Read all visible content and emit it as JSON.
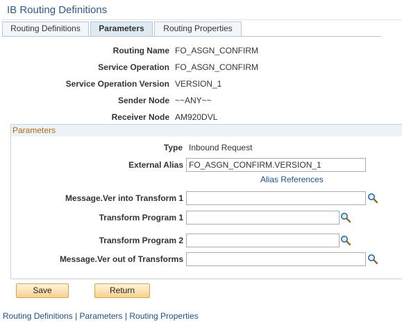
{
  "page": {
    "title": "IB Routing Definitions"
  },
  "tabs": [
    {
      "label": "Routing Definitions",
      "active": false
    },
    {
      "label": "Parameters",
      "active": true
    },
    {
      "label": "Routing Properties",
      "active": false
    }
  ],
  "details": {
    "routing_name_label": "Routing Name",
    "routing_name_value": "FO_ASGN_CONFIRM",
    "service_operation_label": "Service Operation",
    "service_operation_value": "FO_ASGN_CONFIRM",
    "service_operation_version_label": "Service Operation Version",
    "service_operation_version_value": "VERSION_1",
    "sender_node_label": "Sender Node",
    "sender_node_value": "~~ANY~~",
    "receiver_node_label": "Receiver Node",
    "receiver_node_value": "AM920DVL"
  },
  "parameters": {
    "group_title": "Parameters",
    "type_label": "Type",
    "type_value": "Inbound Request",
    "external_alias_label": "External Alias",
    "external_alias_value": "FO_ASGN_CONFIRM.VERSION_1",
    "alias_references_link": "Alias References",
    "msg_ver_into_transform_label": "Message.Ver into Transform 1",
    "msg_ver_into_transform_value": "",
    "transform_program_1_label": "Transform Program 1",
    "transform_program_1_value": "",
    "transform_program_2_label": "Transform Program 2",
    "transform_program_2_value": "",
    "msg_ver_out_label": "Message.Ver out of Transforms",
    "msg_ver_out_value": ""
  },
  "buttons": {
    "save": "Save",
    "return": "Return"
  },
  "footer": {
    "link_routing_definitions": "Routing Definitions",
    "link_parameters": "Parameters",
    "link_routing_properties": "Routing Properties",
    "separator": " | "
  },
  "icons": {
    "lookup": "magnifier-icon"
  },
  "colors": {
    "link": "#1e4f8c",
    "title": "#2c5a8a",
    "group_title": "#b86418",
    "button": "#f6d28f"
  }
}
